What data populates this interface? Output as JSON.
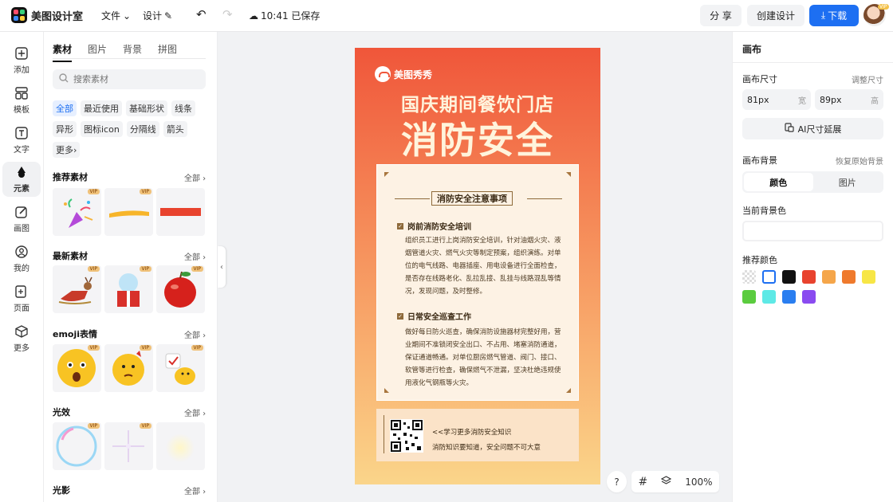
{
  "app": {
    "title": "美图设计室"
  },
  "topbar": {
    "file_menu": "文件",
    "design_menu": "设计",
    "save_status": "10:41 已保存",
    "share": "分 享",
    "create": "创建设计",
    "download": "下载",
    "avatar_badge": "VIP"
  },
  "rail": [
    {
      "label": "添加",
      "icon": "plus-square-icon"
    },
    {
      "label": "模板",
      "icon": "template-icon"
    },
    {
      "label": "文字",
      "icon": "text-icon"
    },
    {
      "label": "元素",
      "icon": "shapes-icon"
    },
    {
      "label": "画图",
      "icon": "draw-icon"
    },
    {
      "label": "我的",
      "icon": "user-icon"
    },
    {
      "label": "页面",
      "icon": "page-add-icon"
    },
    {
      "label": "更多",
      "icon": "cube-icon"
    }
  ],
  "panel": {
    "tabs": [
      "素材",
      "图片",
      "背景",
      "拼图"
    ],
    "search_placeholder": "搜索素材",
    "chips": [
      "全部",
      "最近使用",
      "基础形状",
      "线条",
      "异形",
      "图标icon",
      "分隔线",
      "箭头",
      "更多"
    ],
    "all_label": "全部",
    "vip_label": "VIP",
    "sections": [
      {
        "title": "推荐素材"
      },
      {
        "title": "最新素材"
      },
      {
        "title": "emoji表情"
      },
      {
        "title": "光效"
      },
      {
        "title": "光影"
      }
    ]
  },
  "poster": {
    "brand": "美图秀秀",
    "title_line1": "国庆期间餐饮门店",
    "title_line2": "消防安全",
    "card_heading": "消防安全注意事项",
    "section1_title": "岗前消防安全培训",
    "section1_body": "组织员工进行上岗消防安全培训，针对油烟火灾、液烟管道火灾、燃气火灾等制定预案，组织演练。对单位的电气线路、电器插座、用电设备进行全面检查，是否存在线路老化、乱拉乱接、乱挂与线路混乱等情况，发现问题，及时整修。",
    "section2_title": "日常安全巡查工作",
    "section2_body": "做好每日防火巡查，确保消防设施器材完整好用，营业期间不准锁闭安全出口、不占用、堵塞消防通道，保证通道畅通。对单位厨房燃气管道、阀门、接口、软管等进行检查，确保燃气不泄漏，坚决杜绝违规使用液化气钢瓶等火灾。",
    "qr_line1": "<<学习更多消防安全知识",
    "qr_line2": "消防知识要知道，安全问题不可大意"
  },
  "zoom": {
    "help": "?",
    "level": "100%"
  },
  "right": {
    "title": "画布",
    "size_label": "画布尺寸",
    "adjust_size": "调整尺寸",
    "width_value": "81px",
    "width_unit": "宽",
    "height_value": "89px",
    "height_unit": "高",
    "ai_extend": "AI尺寸延展",
    "bg_label": "画布背景",
    "restore_bg": "恢复原始背景",
    "seg_color": "颜色",
    "seg_image": "图片",
    "current_bg": "当前背景色",
    "recommended": "推荐颜色",
    "swatches": [
      "transparent",
      "#ffffff",
      "#111111",
      "#e8432e",
      "#f5a64a",
      "#ef7a2d",
      "#f7e646",
      "#5bcc3f",
      "#5ee9e6",
      "#2a7ef0",
      "#8a4bf0"
    ]
  }
}
